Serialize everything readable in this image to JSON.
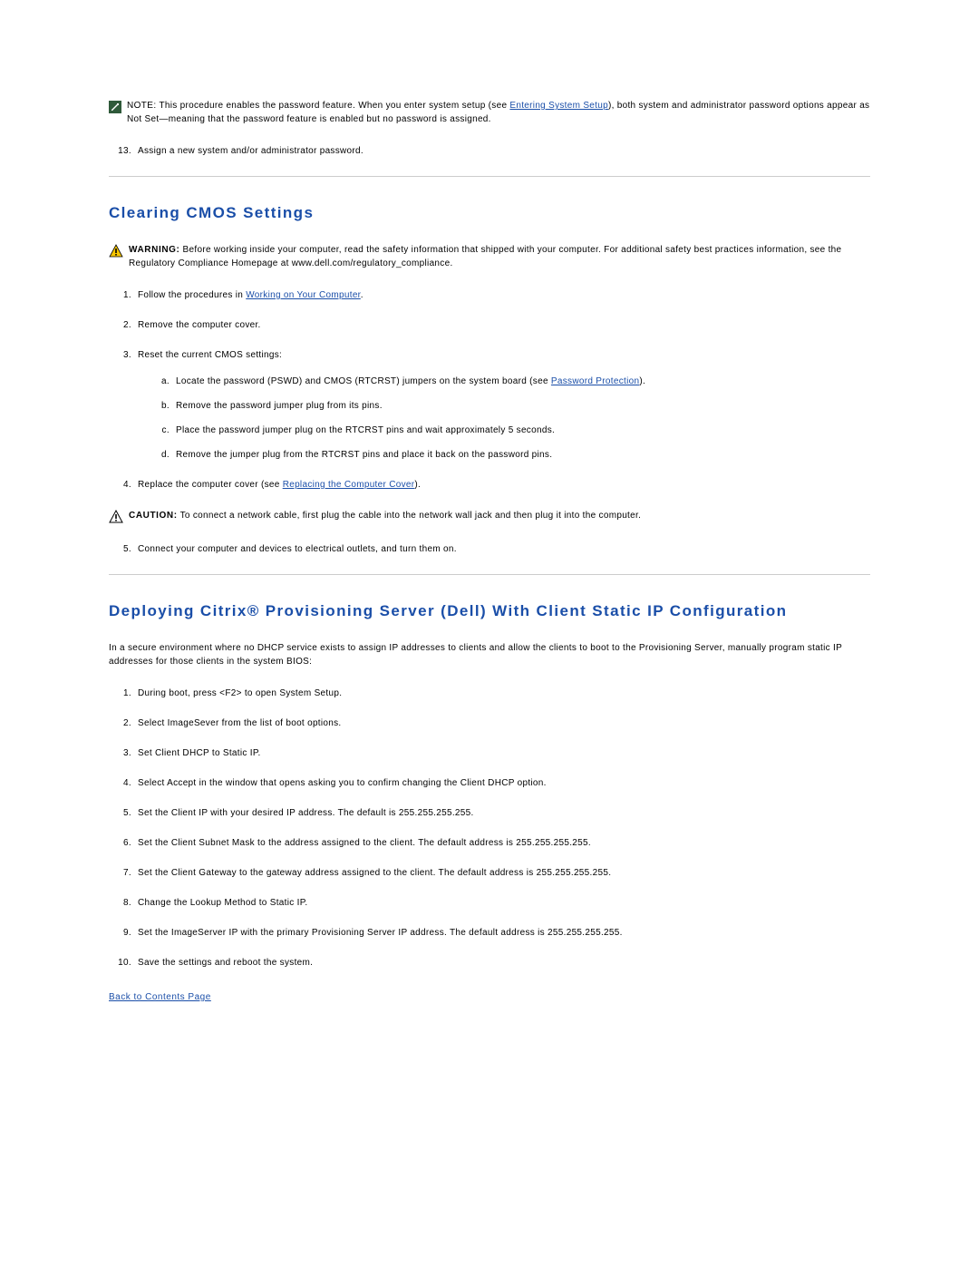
{
  "noteBox": {
    "label": "NOTE:",
    "textBefore": " This procedure enables the password feature. When you enter system setup (see ",
    "link": "Entering System Setup",
    "textAfter": "), both system and administrator password options appear as Not Set—meaning that the password feature is enabled but no password is assigned."
  },
  "firstList": {
    "item13": "Assign a new system and/or administrator password."
  },
  "cmos": {
    "heading": "Clearing CMOS Settings",
    "warning": {
      "label": "WARNING:",
      "text": " Before working inside your computer, read the safety information that shipped with your computer. For additional safety best practices information, see the Regulatory Compliance Homepage at www.dell.com/regulatory_compliance."
    },
    "steps": {
      "s1_before": "Follow the procedures in ",
      "s1_link": "Working on Your Computer",
      "s1_after": ".",
      "s2": "Remove the computer cover.",
      "s3": "Reset the current CMOS settings:",
      "s3a_before": "Locate the password (PSWD) and CMOS (RTCRST) jumpers on the system board (see ",
      "s3a_link": "Password Protection",
      "s3a_after": ").",
      "s3b": "Remove the password jumper plug from its pins.",
      "s3c": "Place the password jumper plug on the RTCRST pins and wait approximately 5 seconds.",
      "s3d": "Remove the jumper plug from the RTCRST pins and place it back on the password pins.",
      "s4_before": "Replace the computer cover (see ",
      "s4_link": "Replacing the Computer Cover",
      "s4_after": ").",
      "s5": "Connect your computer and devices to electrical outlets, and turn them on."
    },
    "caution": {
      "label": "CAUTION:",
      "text": " To connect a network cable, first plug the cable into the network wall jack and then plug it into the computer."
    }
  },
  "citrix": {
    "heading": "Deploying Citrix® Provisioning Server (Dell) With Client Static IP Configuration",
    "intro": "In a secure environment where no DHCP service exists to assign IP addresses to clients and allow the clients to boot to the Provisioning Server, manually program static IP addresses for those clients in the system BIOS:",
    "steps": {
      "s1": "During boot, press <F2> to open System Setup.",
      "s2": "Select ImageSever from the list of boot options.",
      "s3": "Set Client DHCP to Static IP.",
      "s4": "Select Accept in the window that opens asking you to confirm changing the Client DHCP option.",
      "s5": "Set the Client IP with your desired IP address. The default is 255.255.255.255.",
      "s6": "Set the Client Subnet Mask to the address assigned to the client. The default address is 255.255.255.255.",
      "s7": "Set the Client Gateway to the gateway address assigned to the client. The default address is 255.255.255.255.",
      "s8": "Change the Lookup Method to Static IP.",
      "s9": "Set the ImageServer IP with the primary Provisioning Server IP address. The default address is 255.255.255.255.",
      "s10": "Save the settings and reboot the system."
    }
  },
  "backLink": "Back to Contents Page"
}
